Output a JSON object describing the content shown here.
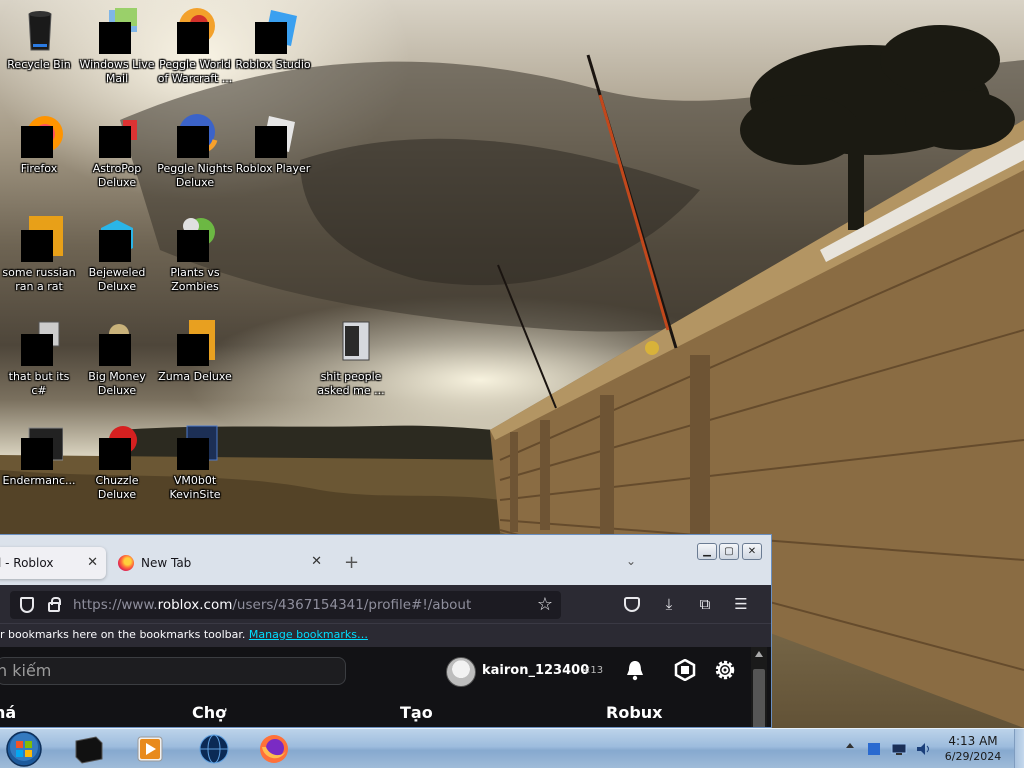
{
  "desktop": {
    "icons": [
      {
        "label": "Recycle Bin"
      },
      {
        "label": "Windows Live Mail"
      },
      {
        "label": "Peggle World of Warcraft ..."
      },
      {
        "label": "Roblox Studio"
      },
      {
        "label": "Firefox"
      },
      {
        "label": "AstroPop Deluxe"
      },
      {
        "label": "Peggle Nights Deluxe"
      },
      {
        "label": "Roblox Player"
      },
      {
        "label": "some russian ran a rat"
      },
      {
        "label": "Bejeweled Deluxe"
      },
      {
        "label": "Plants vs Zombies"
      },
      {
        "label": "that but its c#"
      },
      {
        "label": "Big Money Deluxe"
      },
      {
        "label": "Zuma Deluxe"
      },
      {
        "label": "shit people asked me ..."
      },
      {
        "label": "Endermanc..."
      },
      {
        "label": "Chuzzle Deluxe"
      },
      {
        "label": "VM0b0t KevinSite"
      }
    ]
  },
  "browser": {
    "tabs": [
      {
        "title": "l - Roblox",
        "close": "✕"
      },
      {
        "title": "New Tab",
        "close": "✕"
      }
    ],
    "new_tab_symbol": "+",
    "tab_list_symbol": "⌄",
    "window_buttons": {
      "minimize": "▁",
      "maximize": "▢",
      "close": "✕"
    },
    "url_prefix": "https://www.",
    "url_domain": "roblox.com",
    "url_path": "/users/4367154341/profile#!/about",
    "bookmarks_text": "r bookmarks here on the bookmarks toolbar.",
    "bookmarks_link": "Manage bookmarks…"
  },
  "roblox": {
    "search_placeholder": "n kiếm",
    "username": "kairon_123400",
    "age_badge": "<13",
    "nav": [
      "há",
      "Chợ",
      "Tạo",
      "Robux"
    ]
  },
  "taskbar": {
    "time": "4:13 AM",
    "date": "6/29/2024"
  },
  "colors": {
    "taskbar": "#9dbcdd",
    "browser_dark": "#1c1b22",
    "roblox_bg": "#121215",
    "link": "#00ddff"
  },
  "icon_names": [
    "recycle-bin-icon",
    "firefox-icon",
    "bell-icon",
    "robux-icon",
    "gear-icon",
    "windows-start-icon"
  ]
}
